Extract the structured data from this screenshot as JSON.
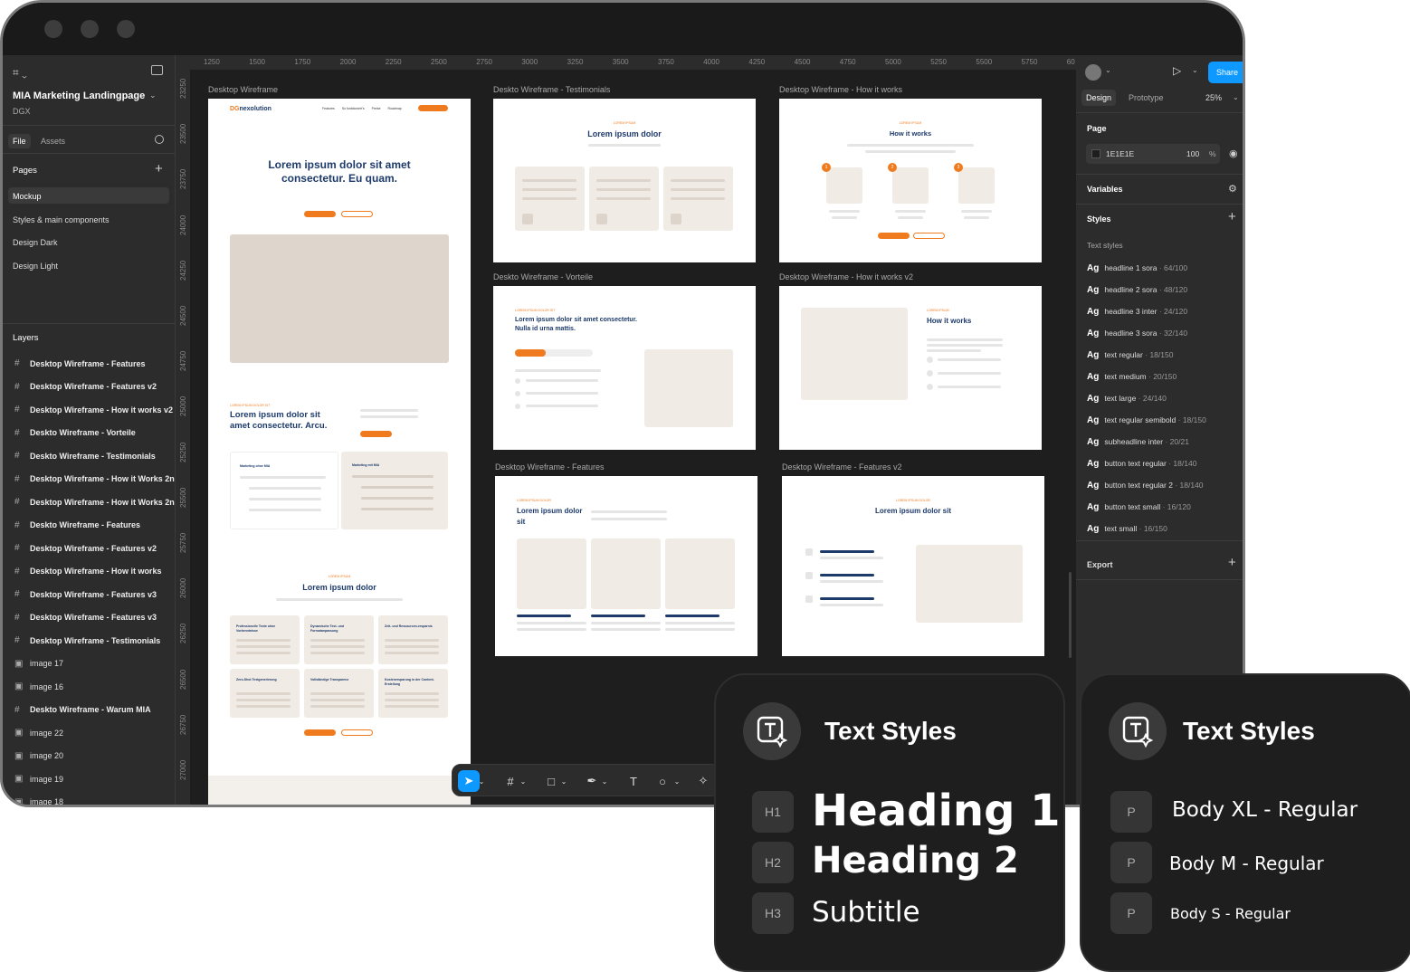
{
  "app": {
    "file_name": "MIA Marketing Landingpage",
    "team": "DGX",
    "tabs": [
      "File",
      "Assets"
    ],
    "pages_title": "Pages",
    "layers_title": "Layers"
  },
  "pages": [
    "Mockup",
    "Styles & main components",
    "Design Dark",
    "Design Light"
  ],
  "layers": [
    {
      "icon": "frame",
      "label": "Desktop Wireframe - Features"
    },
    {
      "icon": "frame",
      "label": "Desktop Wireframe - Features v2"
    },
    {
      "icon": "frame",
      "label": "Desktop Wireframe - How it works v2"
    },
    {
      "icon": "frame",
      "label": "Deskto Wireframe - Vorteile"
    },
    {
      "icon": "frame",
      "label": "Deskto Wireframe - Testimonials"
    },
    {
      "icon": "frame",
      "label": "Desktop Wireframe - How it Works 2n"
    },
    {
      "icon": "frame",
      "label": "Desktop Wireframe - How it Works 2n"
    },
    {
      "icon": "frame",
      "label": "Deskto Wireframe - Features"
    },
    {
      "icon": "frame",
      "label": "Desktop Wireframe - Features v2"
    },
    {
      "icon": "frame",
      "label": "Desktop Wireframe - How it works"
    },
    {
      "icon": "frame",
      "label": "Desktop Wireframe - Features v3"
    },
    {
      "icon": "frame",
      "label": "Desktop Wireframe - Features v3"
    },
    {
      "icon": "frame",
      "label": "Desktop Wireframe - Testimonials"
    },
    {
      "icon": "image",
      "label": "image 17"
    },
    {
      "icon": "image",
      "label": "image 16"
    },
    {
      "icon": "frame",
      "label": "Deskto Wireframe - Warum MIA"
    },
    {
      "icon": "image",
      "label": "image 22"
    },
    {
      "icon": "image",
      "label": "image 20"
    },
    {
      "icon": "image",
      "label": "image 19"
    },
    {
      "icon": "image",
      "label": "image 18"
    }
  ],
  "ruler_h": [
    "1250",
    "1500",
    "1750",
    "2000",
    "2250",
    "2500",
    "2750",
    "3000",
    "3250",
    "3500",
    "3750",
    "4000",
    "4250",
    "4500",
    "4750",
    "5000",
    "5250",
    "5500",
    "5750",
    "60"
  ],
  "ruler_v": [
    "23250",
    "23500",
    "23750",
    "24000",
    "24250",
    "24500",
    "24750",
    "25000",
    "25250",
    "25500",
    "25750",
    "26000",
    "26250",
    "26500",
    "26750",
    "27000"
  ],
  "frames": {
    "f1": "Desktop Wireframe",
    "f2": "Deskto Wireframe - Testimonials",
    "f3": "Desktop Wireframe - How it works",
    "f4": "Deskto Wireframe - Vorteile",
    "f5": "Desktop Wireframe - How it works v2",
    "f6": "Desktop Wireframe - Features",
    "f7": "Desktop Wireframe - Features v2"
  },
  "wire": {
    "logo_a": "DG",
    "logo_b": "nexolution",
    "nav": [
      "Features",
      "So funktioniert's",
      "Preise",
      "Roadmap"
    ],
    "hero": "Lorem ipsum dolor sit amet consectetur. Eu quam.",
    "sec2_kicker": "LOREM IPSUM DOLOR SIT",
    "sec2": "Lorem ipsum dolor sit amet consectetur. Arcu.",
    "card_a": "Marketing ohne MIA",
    "card_b": "Marketing mit MIA",
    "sec3_kicker": "LOREM IPSUM",
    "sec3": "Lorem ipsum dolor",
    "tiles": [
      "Professionelle Texte ohne Vorkenntnisse",
      "Dynamische Text- und Formatanpassung",
      "Zeit- und Ressourcen-ersparnis",
      "Zero-Shot Textgenerierung",
      "Vollständige Transparenz",
      "Kostenersparung in der Content-Erstellung"
    ],
    "t_kicker": "LOREM IPSUM",
    "t_title": "Lorem ipsum dolor",
    "h_kicker": "LOREM IPSUM",
    "h_title": "How it works",
    "steps": [
      "1",
      "2",
      "3"
    ],
    "v_kicker": "LOREM IPSUM DOLOR SIT",
    "v_title": "Lorem ipsum dolor sit amet consectetur. Nulla id urna mattis.",
    "h2_kicker": "LOREM IPSUM",
    "h2_title": "How it works",
    "f_kicker": "LOREM IPSUM DOLOR",
    "f_title": "Lorem ipsum dolor sit",
    "fv2_kicker": "LOREM IPSUM DOLOR",
    "fv2_title": "Lorem ipsum dolor sit"
  },
  "right": {
    "tabs": [
      "Design",
      "Prototype"
    ],
    "zoom": "25%",
    "share": "Share",
    "page_title": "Page",
    "page_color": "1E1E1E",
    "page_opacity": "100",
    "pct": "%",
    "variables": "Variables",
    "styles": "Styles",
    "text_styles": "Text styles",
    "export": "Export",
    "ag": "Ag",
    "style_items": [
      {
        "name": "headline 1 sora",
        "spec": "64/100"
      },
      {
        "name": "headline 2 sora",
        "spec": "48/120"
      },
      {
        "name": "headline 3 inter",
        "spec": "24/120"
      },
      {
        "name": "headline 3 sora",
        "spec": "32/140"
      },
      {
        "name": "text regular",
        "spec": "18/150"
      },
      {
        "name": "text medium",
        "spec": "20/150"
      },
      {
        "name": "text large",
        "spec": "24/140"
      },
      {
        "name": "text regular semibold",
        "spec": "18/150"
      },
      {
        "name": "subheadline inter",
        "spec": "20/21"
      },
      {
        "name": "button text regular",
        "spec": "18/140"
      },
      {
        "name": "button text regular 2",
        "spec": "18/140"
      },
      {
        "name": "button text small",
        "spec": "16/120"
      },
      {
        "name": "text small",
        "spec": "16/150"
      }
    ]
  },
  "card_left": {
    "title": "Text Styles",
    "items": [
      {
        "badge": "H1",
        "text": "Heading 1"
      },
      {
        "badge": "H2",
        "text": "Heading 2"
      },
      {
        "badge": "H3",
        "text": "Subtitle"
      }
    ]
  },
  "card_right": {
    "title": "Text Styles",
    "items": [
      {
        "badge": "P",
        "text": "Body XL - Regular"
      },
      {
        "badge": "P",
        "text": "Body M - Regular"
      },
      {
        "badge": "P",
        "text": "Body S - Regular"
      }
    ]
  },
  "colors": {
    "accent": "#f07b1e",
    "navy": "#1d3a6b",
    "share": "#0d99ff",
    "beige": "#f0ebe4"
  }
}
